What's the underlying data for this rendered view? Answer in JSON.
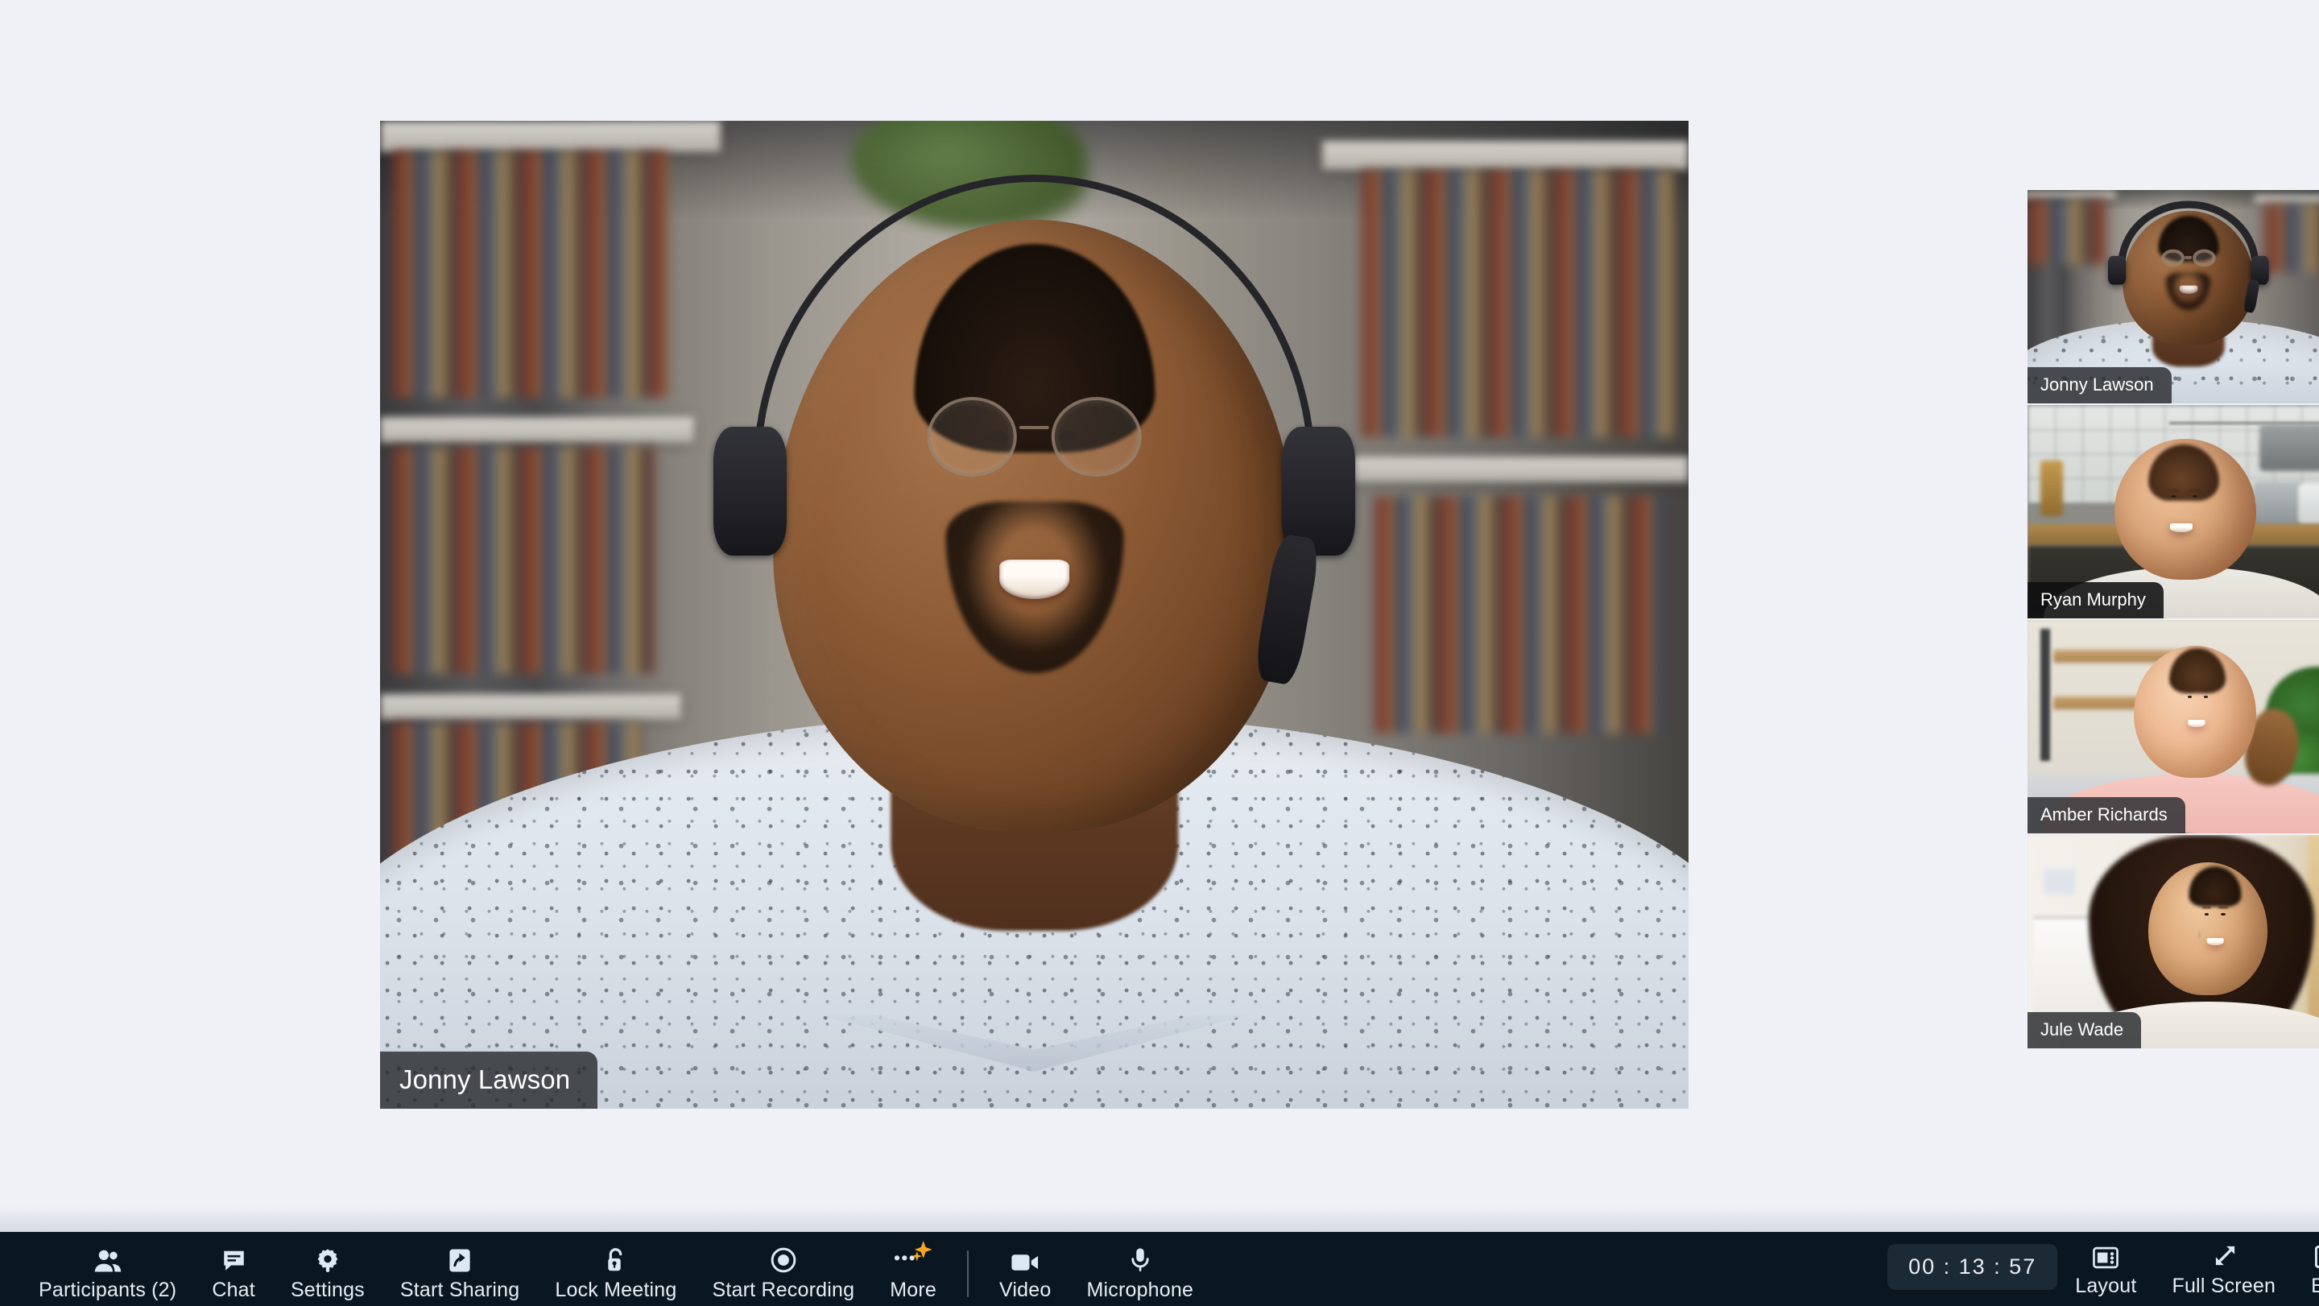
{
  "app": {
    "background_color": "#f0f1f7",
    "toolbar_color": "#0b1720",
    "accent_color": "#f5a623"
  },
  "stage": {
    "active_speaker": "Jonny Lawson"
  },
  "filmstrip": {
    "participants": [
      {
        "name": "Jonny Lawson"
      },
      {
        "name": "Ryan Murphy"
      },
      {
        "name": "Amber Richards"
      },
      {
        "name": "Jule Wade"
      }
    ]
  },
  "toolbar": {
    "left_items": [
      {
        "label": "Participants (2)",
        "icon": "participants-icon"
      },
      {
        "label": "Chat",
        "icon": "chat-icon"
      },
      {
        "label": "Settings",
        "icon": "gear-icon"
      },
      {
        "label": "Start Sharing",
        "icon": "screen-share-icon"
      },
      {
        "label": "Lock Meeting",
        "icon": "unlock-icon"
      },
      {
        "label": "Start Recording",
        "icon": "record-icon"
      },
      {
        "label": "More",
        "icon": "more-sparkle-icon"
      }
    ],
    "media_items": [
      {
        "label": "Video",
        "icon": "camera-icon"
      },
      {
        "label": "Microphone",
        "icon": "microphone-icon"
      }
    ],
    "timer": "00 : 13 : 57",
    "right_items": [
      {
        "label": "Layout",
        "icon": "layout-icon"
      },
      {
        "label": "Full Screen",
        "icon": "fullscreen-icon"
      },
      {
        "label": "Exit",
        "icon": "exit-icon"
      }
    ]
  }
}
